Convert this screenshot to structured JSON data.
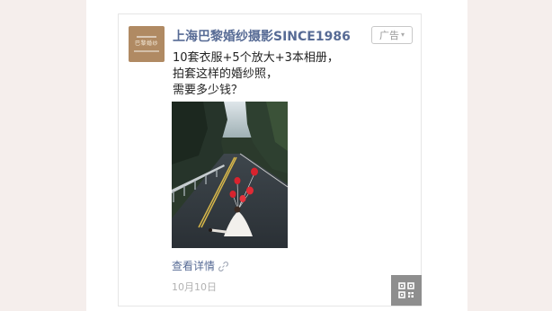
{
  "ad": {
    "account_name": "上海巴黎婚纱摄影SINCE1986",
    "avatar_logo_text": "巴黎婚纱",
    "badge_label": "广告",
    "badge_icon": "chevron-down-icon",
    "content_lines": [
      "10套衣服+5个放大+3本相册，",
      "拍套这样的婚纱照，",
      "需要多少钱？"
    ],
    "image_icon": "wedding-photo",
    "details_label": "查看详情",
    "details_icon": "link-icon",
    "date": "10月10日",
    "qr_icon": "qr-code-icon"
  },
  "colors": {
    "link": "#576b95",
    "page_background": "#f5eeec",
    "avatar": "#b08a63"
  }
}
